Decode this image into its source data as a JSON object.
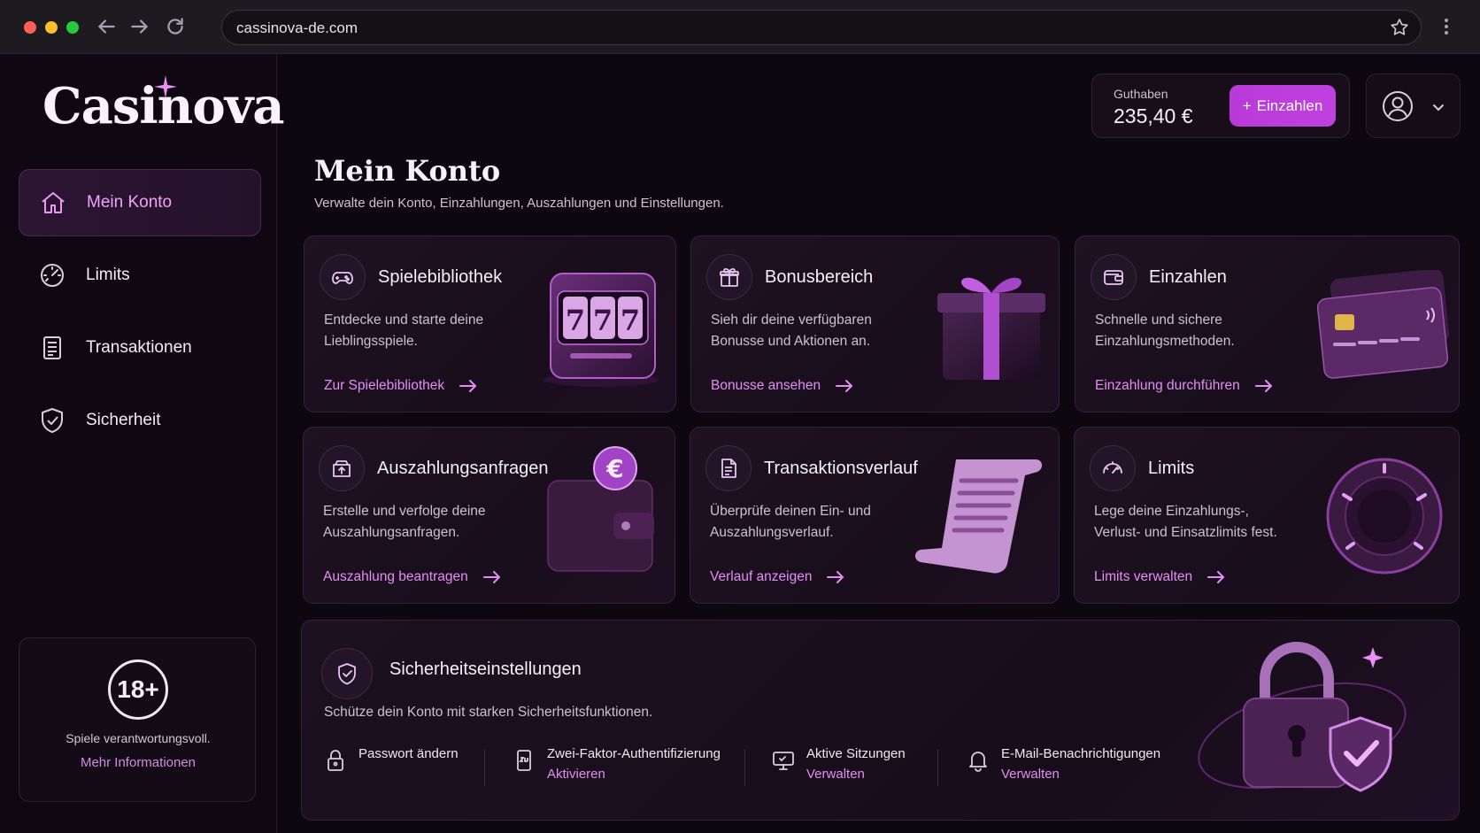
{
  "browser": {
    "url": "cassinova-de.com"
  },
  "brand": {
    "name": "Casinova",
    "accent": "#c041e0"
  },
  "sidebar": {
    "items": [
      {
        "label": "Mein Konto",
        "icon": "home-icon",
        "active": true
      },
      {
        "label": "Limits",
        "icon": "gauge-icon",
        "active": false
      },
      {
        "label": "Transaktionen",
        "icon": "document-icon",
        "active": false
      },
      {
        "label": "Sicherheit",
        "icon": "shield-check-icon",
        "active": false
      }
    ],
    "age": {
      "badge": "18+",
      "text": "Spiele verantwortungsvoll.",
      "link": "Mehr Informationen"
    }
  },
  "header": {
    "balance_label": "Guthaben",
    "balance_value": "235,40 €",
    "deposit_label": "Einzahlen"
  },
  "page": {
    "title": "Mein Konto",
    "subtitle": "Verwalte dein Konto, Einzahlungen, Auszahlungen und Einstellungen."
  },
  "cards": [
    {
      "title": "Spielebibliothek",
      "desc": "Entdecke und starte deine Lieblingsspiele.",
      "link": "Zur Spielebibliothek",
      "icon": "gamepad-icon"
    },
    {
      "title": "Bonusbereich",
      "desc": "Sieh dir deine verfügbaren Bonusse und Aktionen an.",
      "link": "Bonusse ansehen",
      "icon": "gift-icon"
    },
    {
      "title": "Einzahlen",
      "desc": "Schnelle und sichere Einzahlungsmethoden.",
      "link": "Einzahlung durchführen",
      "icon": "wallet-icon"
    },
    {
      "title": "Auszahlungsanfragen",
      "desc": "Erstelle und verfolge deine Auszahlungsanfragen.",
      "link": "Auszahlung beantragen",
      "icon": "box-upload-icon"
    },
    {
      "title": "Transaktionsverlauf",
      "desc": "Überprüfe deinen Ein- und Auszahlungsverlauf.",
      "link": "Verlauf anzeigen",
      "icon": "document-icon"
    },
    {
      "title": "Limits",
      "desc": "Lege deine Einzahlungs-, Verlust- und Einsatzlimits fest.",
      "link": "Limits verwalten",
      "icon": "gauge-icon"
    }
  ],
  "security": {
    "title": "Sicherheitseinstellungen",
    "desc": "Schütze dein Konto mit starken Sicherheitsfunktionen.",
    "items": [
      {
        "title": "Passwort ändern",
        "link": "",
        "icon": "lock-icon"
      },
      {
        "title": "Zwei-Faktor-Authentifizierung",
        "link": "Aktivieren",
        "icon": "phone-2fa-icon"
      },
      {
        "title": "Aktive Sitzungen",
        "link": "Verwalten",
        "icon": "monitor-icon"
      },
      {
        "title": "E-Mail-Benachrichtigungen",
        "link": "Verwalten",
        "icon": "bell-icon"
      }
    ]
  },
  "slot_art": {
    "reels": [
      "7",
      "7",
      "7"
    ]
  },
  "wallet_art": {
    "coin": "€"
  }
}
